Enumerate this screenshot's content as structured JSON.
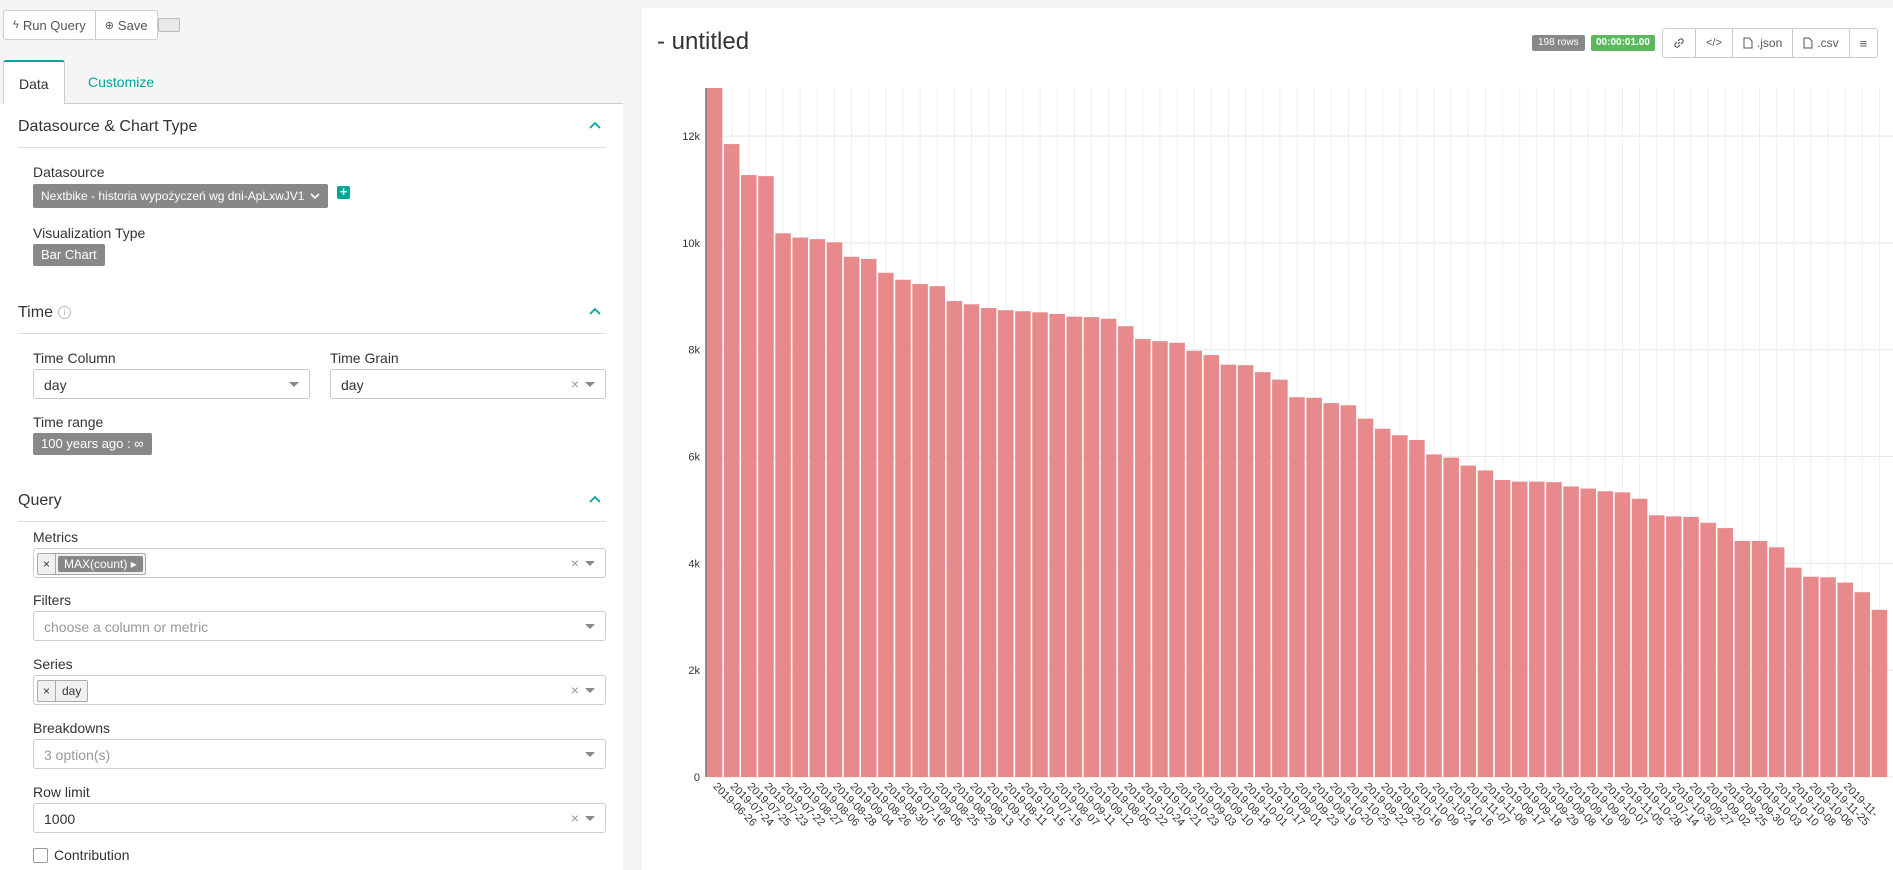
{
  "toolbar": {
    "run_query_label": "Run Query",
    "save_label": "Save"
  },
  "tabs": [
    {
      "label": "Data"
    },
    {
      "label": "Customize"
    }
  ],
  "sections": {
    "datasource": {
      "title": "Datasource & Chart Type",
      "datasource_label": "Datasource",
      "datasource_value": "Nextbike - historia wypożyczeń wg dni-ApLxwJV1",
      "viz_label": "Visualization Type",
      "viz_value": "Bar Chart"
    },
    "time": {
      "title": "Time",
      "time_column_label": "Time Column",
      "time_column_value": "day",
      "time_grain_label": "Time Grain",
      "time_grain_value": "day",
      "time_range_label": "Time range",
      "time_range_value": "100 years ago : ∞"
    },
    "query": {
      "title": "Query",
      "metrics_label": "Metrics",
      "metrics_chip": "MAX(count)",
      "filters_label": "Filters",
      "filters_placeholder": "choose a column or metric",
      "series_label": "Series",
      "series_chip": "day",
      "breakdowns_label": "Breakdowns",
      "breakdowns_placeholder": "3 option(s)",
      "row_limit_label": "Row limit",
      "row_limit_value": "1000",
      "contribution_label": "Contribution"
    }
  },
  "header": {
    "title": "- untitled",
    "rows_badge": "198 rows",
    "time_badge": "00:00:01.00",
    "json_label": ".json",
    "csv_label": ".csv"
  },
  "colors": {
    "bar": "#e8898b",
    "accent": "#00a699",
    "success": "#5cb85c"
  },
  "chart_data": {
    "type": "bar",
    "categories": [
      "2019-06-26",
      "2019-07-24",
      "2019-07-25",
      "2019-07-23",
      "2019-07-22",
      "2019-08-27",
      "2019-08-06",
      "2019-08-28",
      "2019-09-04",
      "2019-08-26",
      "2019-08-30",
      "2019-07-16",
      "2019-09-05",
      "2019-08-25",
      "2019-08-29",
      "2019-08-13",
      "2019-09-15",
      "2019-08-11",
      "2019-10-15",
      "2019-07-15",
      "2019-08-07",
      "2019-09-11",
      "2019-09-12",
      "2019-08-05",
      "2019-10-22",
      "2019-10-24",
      "2019-10-21",
      "2019-10-23",
      "2019-09-03",
      "2019-09-10",
      "2019-08-18",
      "2019-10-01",
      "2019-10-17",
      "2019-09-01",
      "2019-09-23",
      "2019-09-19",
      "2019-10-20",
      "2019-10-25",
      "2019-09-22",
      "2019-09-20",
      "2019-10-16",
      "2019-10-09",
      "2019-10-24",
      "2019-10-16",
      "2019-11-07",
      "2019-11-06",
      "2019-09-17",
      "2019-09-18",
      "2019-09-29",
      "2019-09-08",
      "2019-09-19",
      "2019-09-09",
      "2019-10-07",
      "2019-11-05",
      "2019-10-28",
      "2019-07-14",
      "2019-10-30",
      "2019-09-27",
      "2019-09-02",
      "2019-09-25",
      "2019-09-30",
      "2019-10-03",
      "2019-10-10",
      "2019-10-08",
      "2019-10-06",
      "2019-11-25",
      "2019-11-"
    ],
    "values": [
      12900,
      11850,
      11270,
      11250,
      10180,
      10100,
      10070,
      10010,
      9740,
      9700,
      9440,
      9310,
      9230,
      9190,
      8910,
      8850,
      8780,
      8740,
      8720,
      8700,
      8670,
      8620,
      8610,
      8580,
      8440,
      8200,
      8160,
      8130,
      7980,
      7900,
      7720,
      7710,
      7580,
      7440,
      7110,
      7100,
      7000,
      6960,
      6710,
      6520,
      6400,
      6310,
      6040,
      5980,
      5830,
      5740,
      5560,
      5530,
      5530,
      5520,
      5440,
      5400,
      5350,
      5330,
      5210,
      4900,
      4880,
      4870,
      4760,
      4660,
      4420,
      4420,
      4300,
      3920,
      3750,
      3740,
      3640,
      3460,
      3130
    ],
    "yticks": [
      "0",
      "2k",
      "4k",
      "6k",
      "8k",
      "10k",
      "12k"
    ],
    "ylim": [
      0,
      12900
    ],
    "grid": true
  }
}
